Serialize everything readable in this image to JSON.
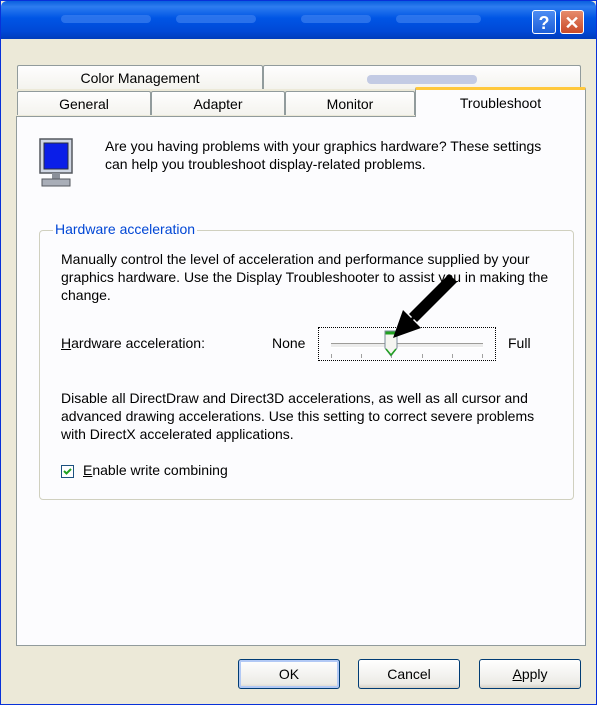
{
  "window": {
    "help_glyph": "?",
    "close_glyph": "✕"
  },
  "tabs": {
    "row_back": [
      {
        "label": "Color Management"
      },
      {
        "label": ""
      }
    ],
    "row_front": [
      {
        "label": "General"
      },
      {
        "label": "Adapter"
      },
      {
        "label": "Monitor"
      },
      {
        "label": "Troubleshoot"
      }
    ],
    "active": "Troubleshoot"
  },
  "intro": {
    "icon": "monitor-icon",
    "text": "Are you having problems with your graphics hardware? These settings can help you troubleshoot display-related problems."
  },
  "hardware": {
    "group_title": "Hardware acceleration",
    "description": "Manually control the level of acceleration and performance supplied by your graphics hardware. Use the Display Troubleshooter to assist you in making the change.",
    "label_mnemonic": "H",
    "label_rest": "ardware acceleration:",
    "slider_min_label": "None",
    "slider_max_label": "Full",
    "slider_level": 2,
    "slider_levels": 6,
    "level_description": "Disable all DirectDraw and Direct3D accelerations, as well as all cursor and advanced drawing accelerations. Use this setting to correct severe problems with DirectX accelerated applications.",
    "write_combining": {
      "checked": true,
      "label_mnemonic": "E",
      "label_rest": "nable write combining"
    }
  },
  "buttons": {
    "ok": "OK",
    "cancel": "Cancel",
    "apply_mnemonic": "A",
    "apply_rest": "pply"
  },
  "colors": {
    "titlebar": "#0055e5",
    "group_title": "#0046d5",
    "active_tab_accent": "#ffc83c",
    "dialog_bg": "#ece9d8"
  }
}
